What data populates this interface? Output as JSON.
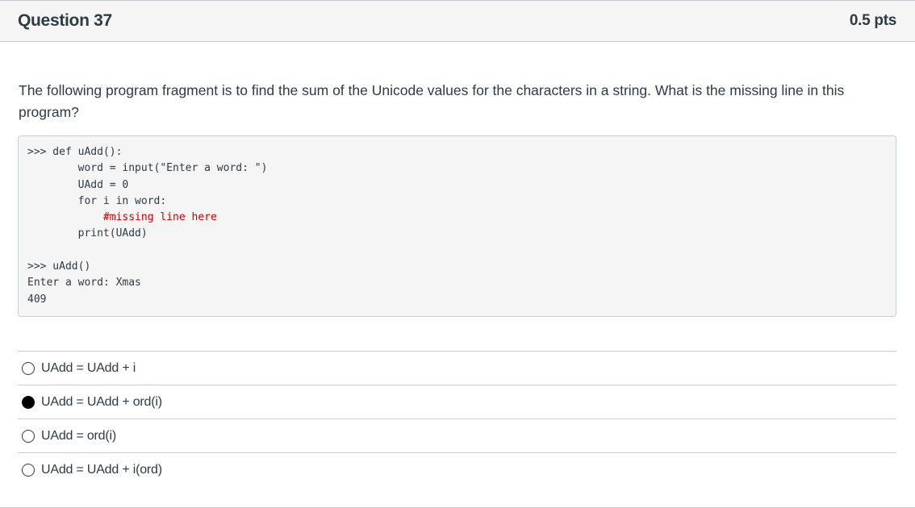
{
  "header": {
    "title": "Question 37",
    "points": "0.5 pts"
  },
  "question_text": "The following program fragment is to find the sum of the Unicode values for the characters in a string. What is the missing line in this program?",
  "code": {
    "lines": [
      ">>> def uAdd():",
      "        word = input(\"Enter a word: \")",
      "        UAdd = 0",
      "        for i in word:",
      "            #missing line here",
      "        print(UAdd)",
      "",
      ">>> uAdd()",
      "Enter a word: Xmas",
      "409"
    ],
    "comment_color": "#cc0000"
  },
  "answers": [
    {
      "label": "UAdd = UAdd + i",
      "selected": false
    },
    {
      "label": "UAdd = UAdd + ord(i)",
      "selected": true
    },
    {
      "label": "UAdd = ord(i)",
      "selected": false
    },
    {
      "label": "UAdd = UAdd + i(ord)",
      "selected": false
    }
  ]
}
